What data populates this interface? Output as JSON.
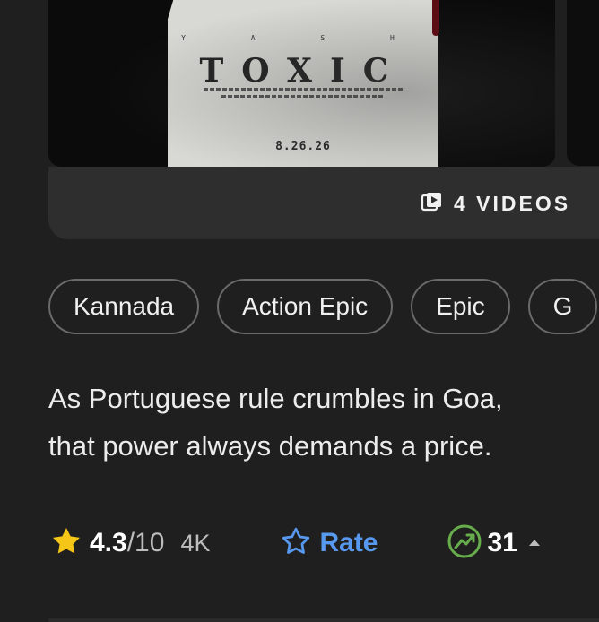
{
  "media": {
    "poster": {
      "top_credit": "Y A S H",
      "title": "TOXIC",
      "date_text": "8.26.26"
    },
    "videos_label": "4 VIDEOS"
  },
  "genres": [
    "Kannada",
    "Action Epic",
    "Epic",
    "G"
  ],
  "description": {
    "line1": "As Portuguese rule crumbles in Goa,",
    "line2": "that power always demands a price."
  },
  "rating": {
    "score": "4.3",
    "out_of": "/10",
    "count": "4K",
    "star_color": "#f5c518"
  },
  "rate": {
    "label": "Rate",
    "color": "#5799ef"
  },
  "popularity": {
    "value": "31",
    "icon_color": "#67ad4b"
  },
  "icons": {
    "videos": "video-library-icon",
    "star": "star-icon",
    "rate": "star-outline-icon",
    "popularity": "trending-up-icon",
    "arrow": "caret-up-icon"
  }
}
